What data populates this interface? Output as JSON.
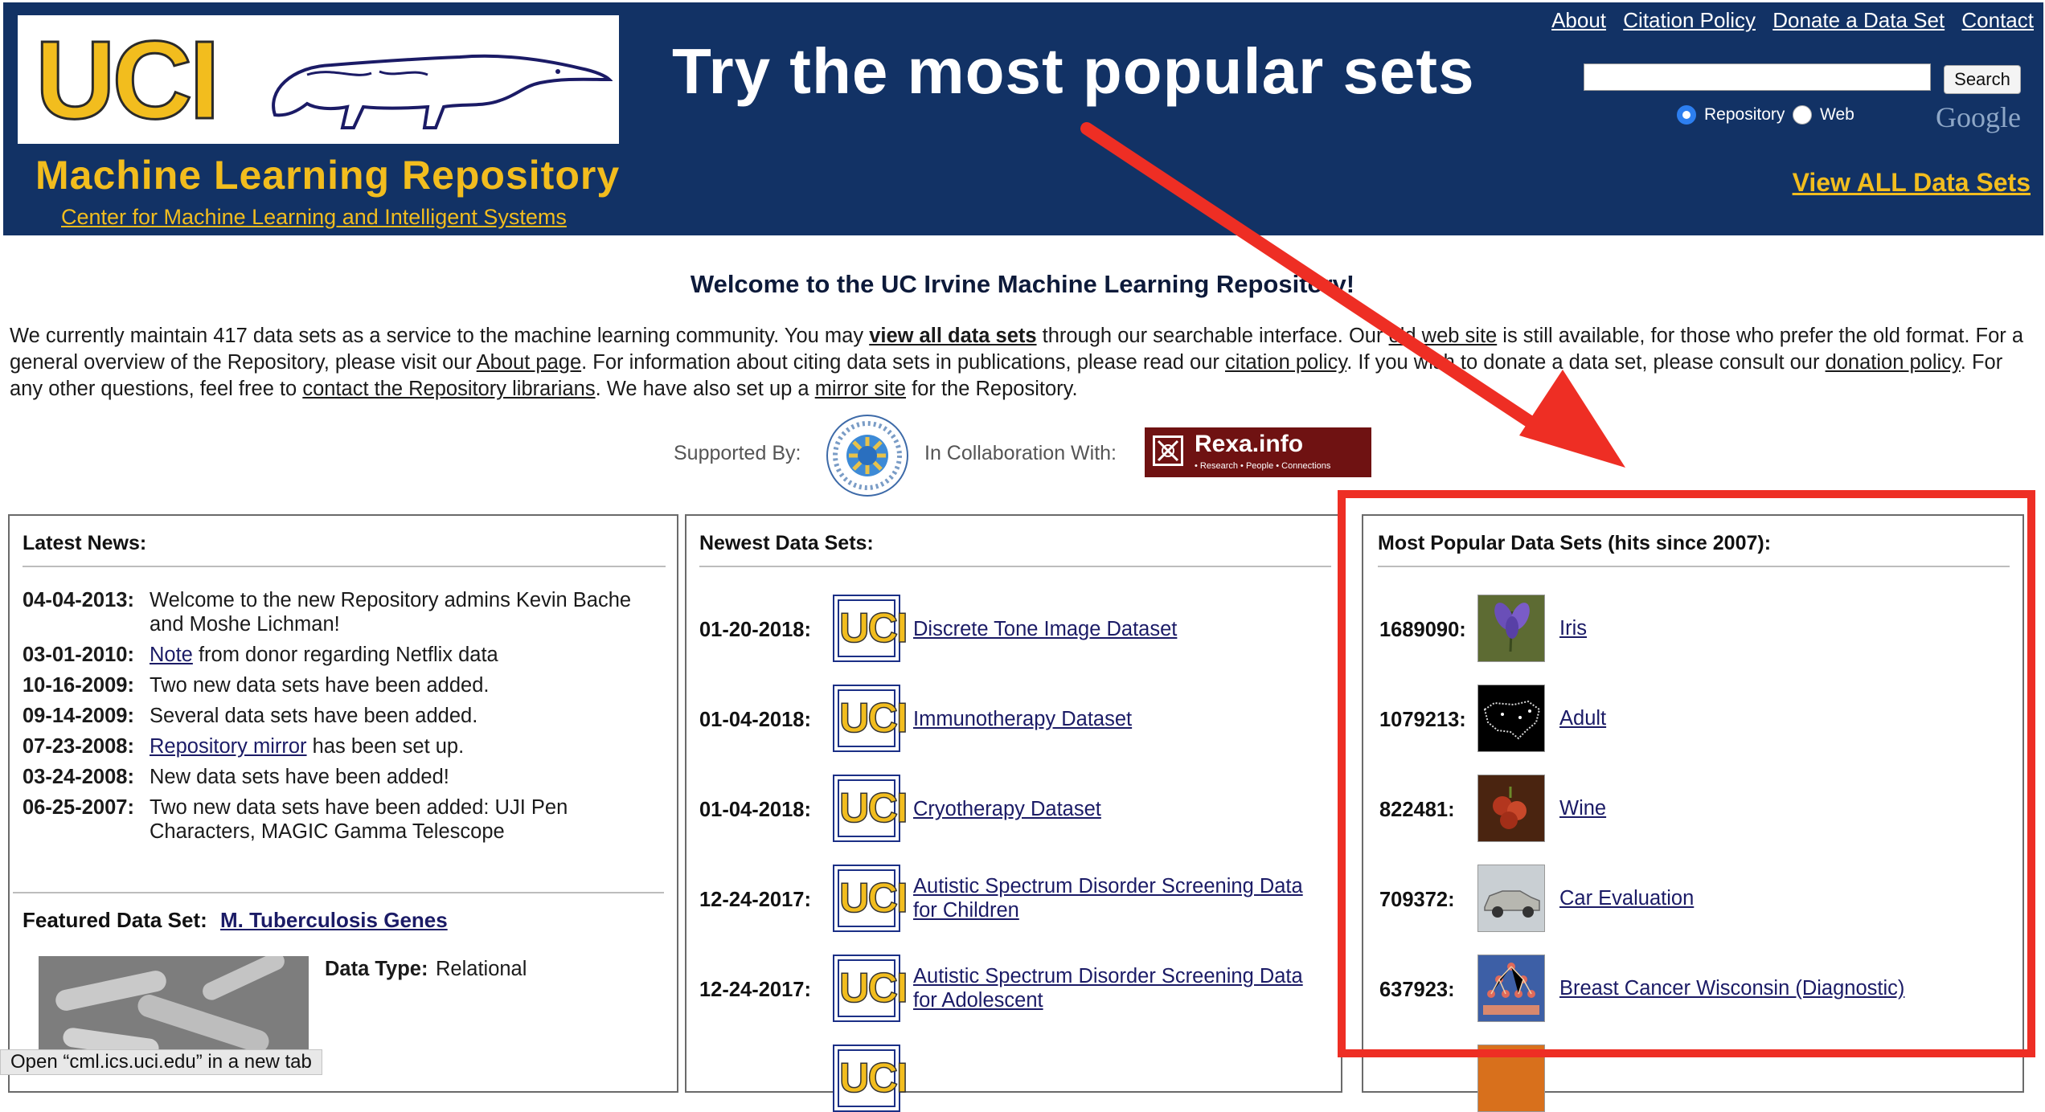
{
  "header": {
    "logo_text": "UCI",
    "site_title": "Machine Learning Repository",
    "center_link": "Center for Machine Learning and Intelligent Systems",
    "headline": "Try the most popular sets",
    "top_links": [
      "About",
      "Citation Policy",
      "Donate a Data Set",
      "Contact"
    ],
    "search": {
      "value": "",
      "placeholder": "",
      "button_label": "Search"
    },
    "radio_options": [
      {
        "label": "Repository",
        "selected": true
      },
      {
        "label": "Web",
        "selected": false
      }
    ],
    "search_provider": "Google",
    "view_all_label": "View ALL Data Sets",
    "colors": {
      "background": "#123265",
      "accent": "#f2bd1e"
    }
  },
  "welcome": {
    "title": "Welcome to the UC Irvine Machine Learning Repository!",
    "intro": {
      "t1": "We currently maintain 417 data sets as a service to the machine learning community. You may ",
      "l1": "view all data sets",
      "t2": " through our searchable interface. Our ",
      "l2": "old web site",
      "t3": " is still available, for those who prefer the old format. For a general overview of the Repository, please visit our ",
      "l3": "About page",
      "t4": ". For information about citing data sets in publications, please read our ",
      "l4": "citation policy",
      "t5": ". If you wish to donate a data set, please consult our ",
      "l5": "donation policy",
      "t6": ". For any other questions, feel free to ",
      "l6": "contact the Repository librarians",
      "t7": ". We have also set up a ",
      "l7": "mirror site",
      "t8": " for the Repository."
    },
    "supported_label": "Supported By:",
    "collab_label": "In Collaboration With:",
    "rexa": {
      "name": "Rexa.info",
      "tagline": "• Research • People • Connections"
    }
  },
  "news": {
    "title": "Latest News:",
    "items": [
      {
        "date": "04-04-2013:",
        "text": "Welcome to the new Repository admins Kevin Bache and Moshe Lichman!"
      },
      {
        "date": "03-01-2010:",
        "link": "Note",
        "text": " from donor regarding Netflix data"
      },
      {
        "date": "10-16-2009:",
        "text": "Two new data sets have been added."
      },
      {
        "date": "09-14-2009:",
        "text": "Several data sets have been added."
      },
      {
        "date": "07-23-2008:",
        "link": "Repository mirror",
        "text": " has been set up."
      },
      {
        "date": "03-24-2008:",
        "text": "New data sets have been added!"
      },
      {
        "date": "06-25-2007:",
        "text": "Two new data sets have been added: UJI Pen Characters, MAGIC Gamma Telescope"
      }
    ],
    "featured": {
      "label": "Featured Data Set:",
      "name": "M. Tuberculosis Genes",
      "type_label": "Data Type:",
      "type_value": "Relational"
    }
  },
  "newest": {
    "title": "Newest Data Sets:",
    "items": [
      {
        "date": "01-20-2018:",
        "name": "Discrete Tone Image Dataset"
      },
      {
        "date": "01-04-2018:",
        "name": "Immunotherapy Dataset"
      },
      {
        "date": "01-04-2018:",
        "name": "Cryotherapy Dataset"
      },
      {
        "date": "12-24-2017:",
        "name": "Autistic Spectrum Disorder Screening Data for Children"
      },
      {
        "date": "12-24-2017:",
        "name": "Autistic Spectrum Disorder Screening Data for Adolescent"
      }
    ],
    "icon_text": "UCI"
  },
  "popular": {
    "title": "Most Popular Data Sets (hits since 2007):",
    "items": [
      {
        "hits": "1689090:",
        "name": "Iris",
        "thumb": "iris-flower"
      },
      {
        "hits": "1079213:",
        "name": "Adult",
        "thumb": "us-map"
      },
      {
        "hits": "822481:",
        "name": "Wine",
        "thumb": "grapes"
      },
      {
        "hits": "709372:",
        "name": "Car Evaluation",
        "thumb": "car"
      },
      {
        "hits": "637923:",
        "name": "Breast Cancer Wisconsin (Diagnostic)",
        "thumb": "tree-diagram"
      }
    ],
    "highlight_color": "#ee2e24"
  },
  "status_bar": "Open “cml.ics.uci.edu” in a new tab"
}
